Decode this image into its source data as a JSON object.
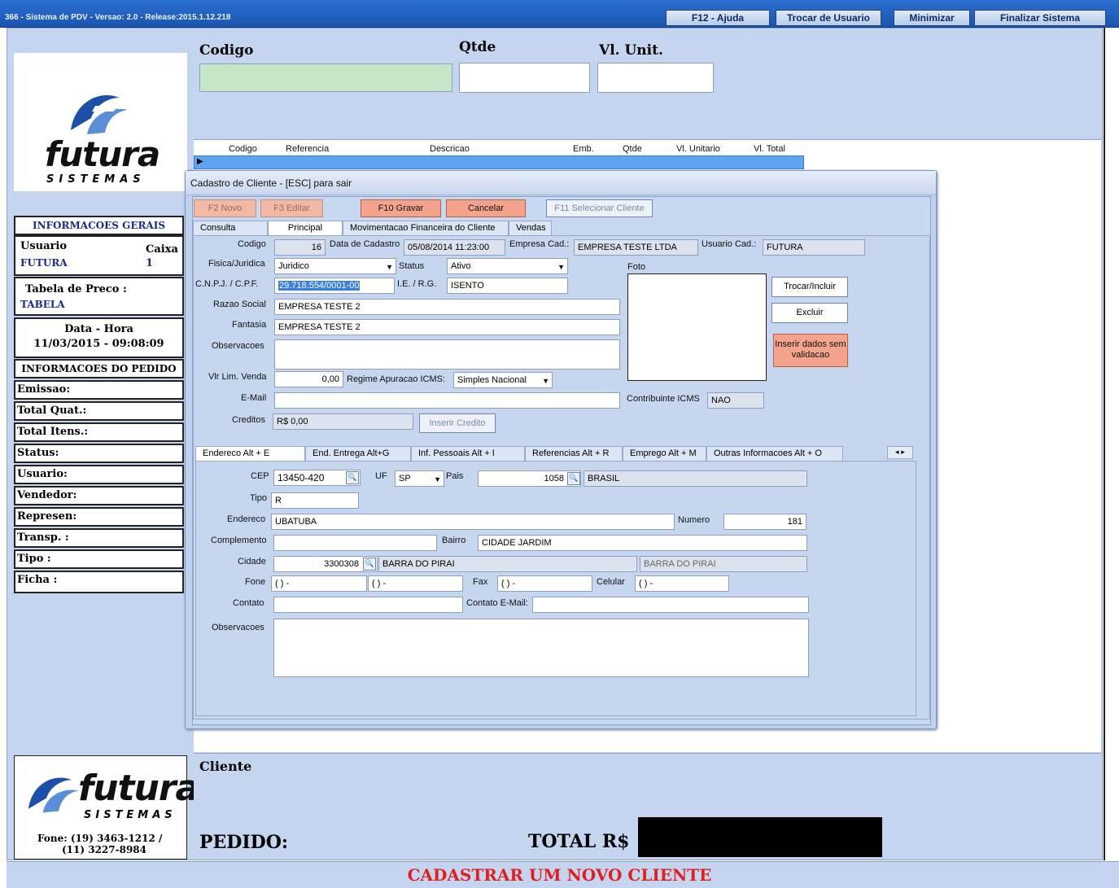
{
  "window": {
    "title": "366 - Sistema de PDV - Versao: 2.0 - Release:2015.1.12.218",
    "buttons": [
      "F12 - Ajuda",
      "Trocar de Usuario",
      "Minimizar",
      "Finalizar Sistema"
    ]
  },
  "entry": {
    "codigo_label": "Codigo",
    "qtde_label": "Qtde",
    "vlunit_label": "Vl. Unit."
  },
  "grid": {
    "columns": [
      "Codigo",
      "Referencia",
      "Descricao",
      "Emb.",
      "Qtde",
      "Vl. Unitario",
      "Vl. Total"
    ]
  },
  "left": {
    "logo_word": "futura",
    "logo_sub": "SISTEMAS",
    "info_title": "INFORMACOES GERAIS",
    "usuario_label": "Usuario",
    "usuario_value": "FUTURA",
    "caixa_label": "Caixa",
    "caixa_value": "1",
    "tabela_label": "Tabela de Preco :",
    "tabela_value": "TABELA",
    "datahora_label": "Data - Hora",
    "datahora_value": "11/03/2015 - 09:08:09",
    "pedido_title": "INFORMACOES DO PEDIDO",
    "pedido_rows": [
      "Emissao:",
      "Total Quat.:",
      "Total Itens.:",
      "Status:",
      "Usuario:",
      "Vendedor:",
      "Represen:",
      "Transp. :",
      "Tipo :",
      "Ficha :"
    ],
    "fone": "Fone: (19) 3463-1212 /",
    "fone2": "(11) 3227-8984"
  },
  "bottom": {
    "cliente_label": "Cliente",
    "pedido_label": "PEDIDO:",
    "total_label": "TOTAL R$",
    "caption": "CADASTRAR UM NOVO CLIENTE"
  },
  "dialog": {
    "title": "Cadastro de Cliente - [ESC] para sair",
    "buttons": {
      "novo": "F2 Novo",
      "editar": "F3 Editar",
      "gravar": "F10 Gravar",
      "cancelar": "Cancelar",
      "selecionar": "F11 Selecionar Cliente"
    },
    "tabs": [
      "Consulta",
      "Principal",
      "Movimentacao Financeira do Cliente",
      "Vendas"
    ],
    "codigo_label": "Codigo",
    "codigo_value": "16",
    "data_cad_label": "Data de Cadastro",
    "data_cad_value": "05/08/2014 11:23:00",
    "empresa_label": "Empresa Cad.:",
    "empresa_value": "EMPRESA TESTE LTDA",
    "usuario_cad_label": "Usuario Cad.:",
    "usuario_cad_value": "FUTURA",
    "fisica_label": "Fisica/Juridica",
    "fisica_value": "Juridico",
    "status_label": "Status",
    "status_value": "Ativo",
    "foto_label": "Foto",
    "cnpj_label": "C.N.P.J. / C.P.F.",
    "cnpj_value": "29.718.554/0001-00",
    "ie_label": "I.E. / R.G.",
    "ie_value": "ISENTO",
    "razao_label": "Razao Social",
    "razao_value": "EMPRESA TESTE 2",
    "fantasia_label": "Fantasia",
    "fantasia_value": "EMPRESA TESTE 2",
    "obs_label": "Observacoes",
    "vlr_lim_label": "Vlr Lim. Venda",
    "vlr_lim_value": "0,00",
    "regime_label": "Regime Apuracao ICMS:",
    "regime_value": "Simples Nacional",
    "email_label": "E-Mail",
    "contrib_label": "Contribuinte ICMS",
    "contrib_value": "NAO",
    "creditos_label": "Creditos",
    "creditos_value": "R$ 0,00",
    "inserir_credito": "Inserir Credito",
    "trocar_incluir": "Trocar/Incluir",
    "excluir": "Excluir",
    "inserir_dados": "Inserir dados sem validacao",
    "subtabs": [
      "Endereco Alt + E",
      "End. Entrega Alt+G",
      "Inf. Pessoais Alt + I",
      "Referencias Alt + R",
      "Emprego Alt + M",
      "Outras Informacoes Alt + O"
    ],
    "cep_label": "CEP",
    "cep_value": "13450-420",
    "uf_label": "UF",
    "uf_value": "SP",
    "pais_label": "Pais",
    "pais_code": "1058",
    "pais_name": "BRASIL",
    "tipo_label": "Tipo",
    "tipo_value": "R",
    "endereco_label": "Endereco",
    "endereco_value": "UBATUBA",
    "numero_label": "Numero",
    "numero_value": "181",
    "complemento_label": "Complemento",
    "bairro_label": "Bairro",
    "bairro_value": "CIDADE JARDIM",
    "cidade_label": "Cidade",
    "cidade_code": "3300308",
    "cidade_name": "BARRA DO PIRAI",
    "cidade_name2": "BARRA DO PIRAI",
    "fone_label": "Fone",
    "fone1": "( )  -",
    "fone2": "( )  -",
    "fax_label": "Fax",
    "fax_value": "( )  -",
    "celular_label": "Celular",
    "celular_value": "( )  -",
    "contato_label": "Contato",
    "contato_email_label": "Contato E-Mail:",
    "obs2_label": "Observacoes"
  }
}
